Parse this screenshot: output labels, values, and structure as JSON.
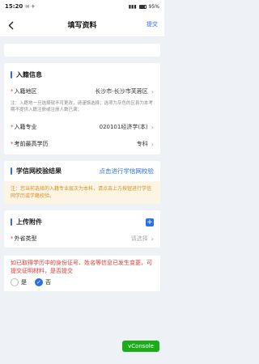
{
  "status_bar": {
    "time": "15:20",
    "battery": "95%"
  },
  "header": {
    "title": "填写资料",
    "submit_label": "提交"
  },
  "enrollment": {
    "section_title": "入籍信息",
    "region": {
      "label": "入籍地区",
      "value": "长沙市-长沙市芙蓉区"
    },
    "region_note": "注：入籍地一旦选择就不可更改，请谨慎选择；选项为灰色的区县为本考期不提供入籍注册或注册人数已满；",
    "major": {
      "label": "入籍专业",
      "value": "020101经济学(本)"
    },
    "education": {
      "label": "考前最高学历",
      "value": "专科"
    }
  },
  "verification": {
    "title": "学信网校验结果",
    "link": "点击进行学信网校验",
    "warning": "注：您当前选择的入籍专业层次为本科，请点击上方按钮进行学信网学历或学籍校验。"
  },
  "attachments": {
    "title": "上传附件",
    "add_icon": "+",
    "province_type": {
      "label": "外省类型",
      "placeholder": "请选择"
    }
  },
  "question": {
    "text": "如已取得学历中的身份证号、姓名等信息已发生变更，可提交证明材料，是否提交",
    "options": [
      {
        "label": "是",
        "checked": false
      },
      {
        "label": "否",
        "checked": true
      }
    ]
  },
  "vconsole_label": "vConsole"
}
